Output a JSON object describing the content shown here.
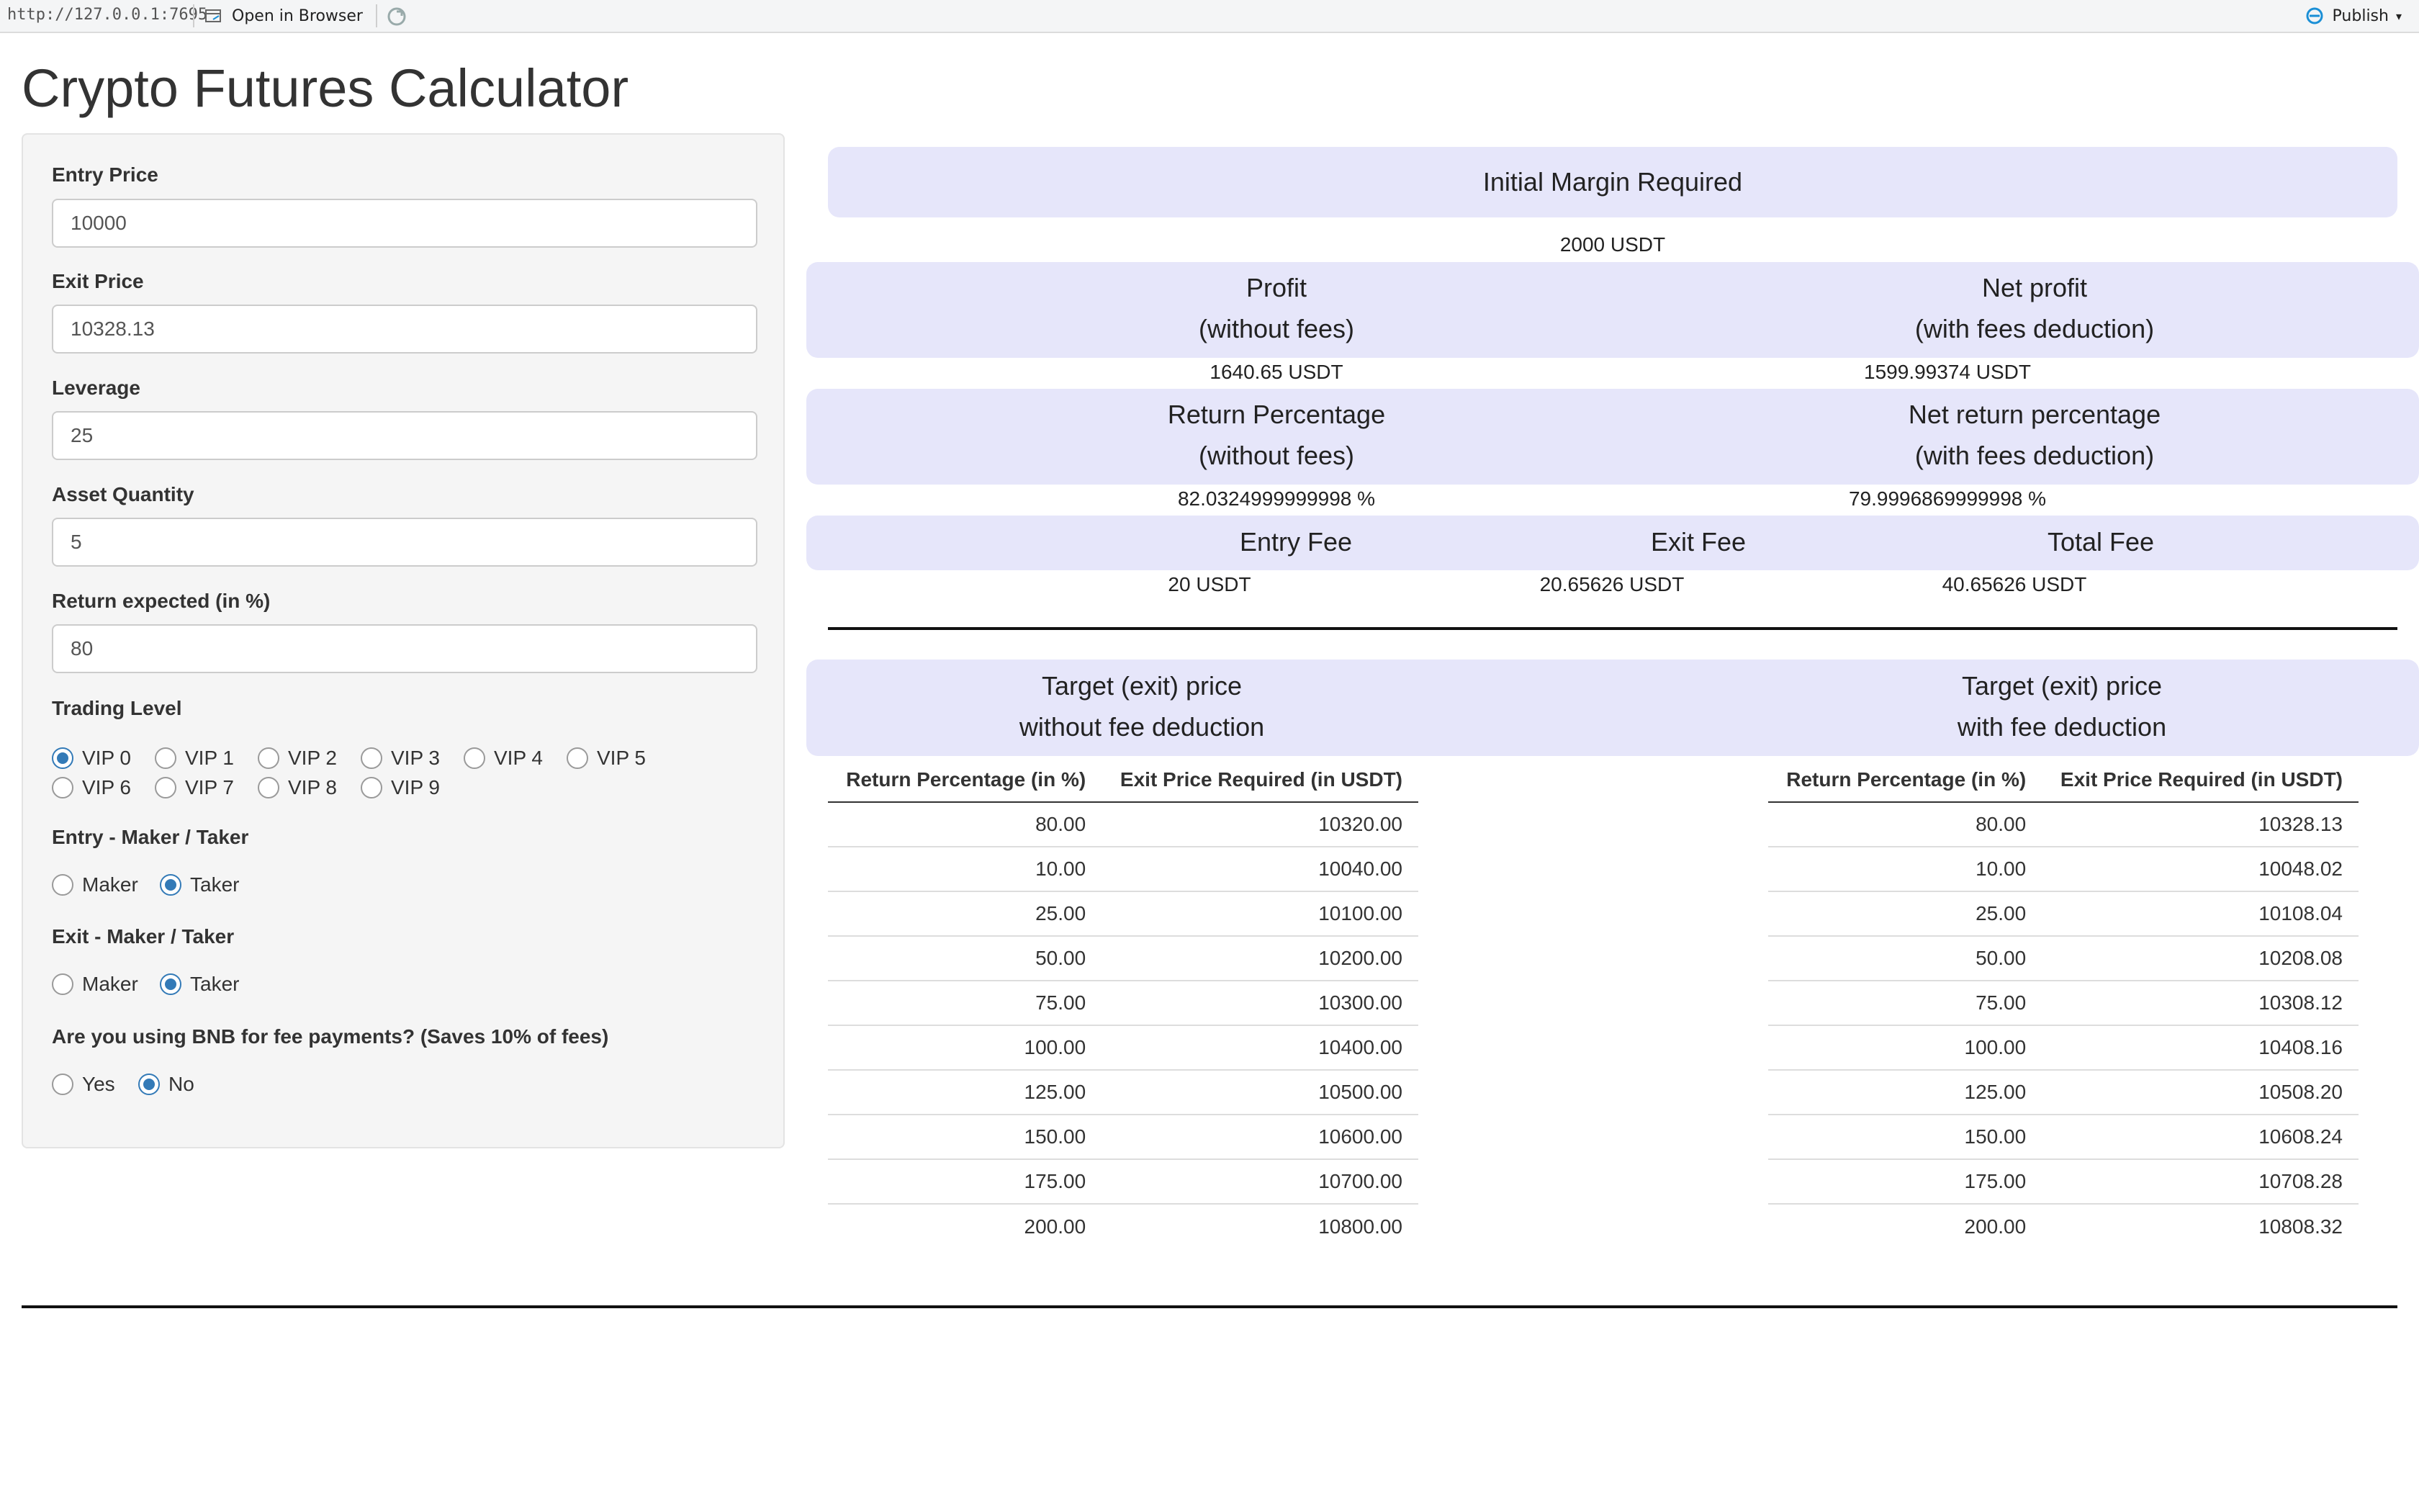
{
  "toolbar": {
    "url": "http://127.0.0.1:7695",
    "open_in_browser": "Open in Browser",
    "publish": "Publish",
    "accent": "#1a8fd6"
  },
  "page": {
    "title": "Crypto Futures Calculator"
  },
  "sidebar": {
    "entry_price_label": "Entry Price",
    "entry_price_value": "10000",
    "exit_price_label": "Exit Price",
    "exit_price_value": "10328.13",
    "leverage_label": "Leverage",
    "leverage_value": "25",
    "asset_quantity_label": "Asset Quantity",
    "asset_quantity_value": "5",
    "return_expected_label": "Return expected (in %)",
    "return_expected_value": "80",
    "trading_level_label": "Trading Level",
    "trading_levels": [
      "VIP 0",
      "VIP 1",
      "VIP 2",
      "VIP 3",
      "VIP 4",
      "VIP 5",
      "VIP 6",
      "VIP 7",
      "VIP 8",
      "VIP 9"
    ],
    "trading_level_selected": "VIP 0",
    "entry_mt_label": "Entry - Maker / Taker",
    "entry_mt_options": [
      "Maker",
      "Taker"
    ],
    "entry_mt_selected": "Taker",
    "exit_mt_label": "Exit - Maker / Taker",
    "exit_mt_options": [
      "Maker",
      "Taker"
    ],
    "exit_mt_selected": "Taker",
    "bnb_label": "Are you using BNB for fee payments? (Saves 10% of fees)",
    "bnb_options": [
      "Yes",
      "No"
    ],
    "bnb_selected": "No"
  },
  "results": {
    "initial_margin_header": "Initial Margin Required",
    "initial_margin_value": "2000 USDT",
    "profit_header_1": "Profit",
    "profit_header_2": "(without fees)",
    "profit_value": "1640.65 USDT",
    "net_profit_header_1": "Net profit",
    "net_profit_header_2": "(with fees deduction)",
    "net_profit_value": "1599.99374 USDT",
    "return_pct_header_1": "Return Percentage",
    "return_pct_header_2": "(without fees)",
    "return_pct_value": "82.0324999999998 %",
    "net_return_header_1": "Net return percentage",
    "net_return_header_2": "(with fees deduction)",
    "net_return_value": "79.9996869999998 %",
    "entry_fee_header": "Entry Fee",
    "entry_fee_value": "20 USDT",
    "exit_fee_header": "Exit Fee",
    "exit_fee_value": "20.65626 USDT",
    "total_fee_header": "Total Fee",
    "total_fee_value": "40.65626 USDT"
  },
  "targets": {
    "left_header_1": "Target (exit) price",
    "left_header_2": "without fee deduction",
    "right_header_1": "Target (exit) price",
    "right_header_2": "with fee deduction",
    "columns": [
      "Return Percentage (in %)",
      "Exit Price Required (in USDT)"
    ],
    "left_rows": [
      [
        "80.00",
        "10320.00"
      ],
      [
        "10.00",
        "10040.00"
      ],
      [
        "25.00",
        "10100.00"
      ],
      [
        "50.00",
        "10200.00"
      ],
      [
        "75.00",
        "10300.00"
      ],
      [
        "100.00",
        "10400.00"
      ],
      [
        "125.00",
        "10500.00"
      ],
      [
        "150.00",
        "10600.00"
      ],
      [
        "175.00",
        "10700.00"
      ],
      [
        "200.00",
        "10800.00"
      ]
    ],
    "right_rows": [
      [
        "80.00",
        "10328.13"
      ],
      [
        "10.00",
        "10048.02"
      ],
      [
        "25.00",
        "10108.04"
      ],
      [
        "50.00",
        "10208.08"
      ],
      [
        "75.00",
        "10308.12"
      ],
      [
        "100.00",
        "10408.16"
      ],
      [
        "125.00",
        "10508.20"
      ],
      [
        "150.00",
        "10608.24"
      ],
      [
        "175.00",
        "10708.28"
      ],
      [
        "200.00",
        "10808.32"
      ]
    ]
  }
}
